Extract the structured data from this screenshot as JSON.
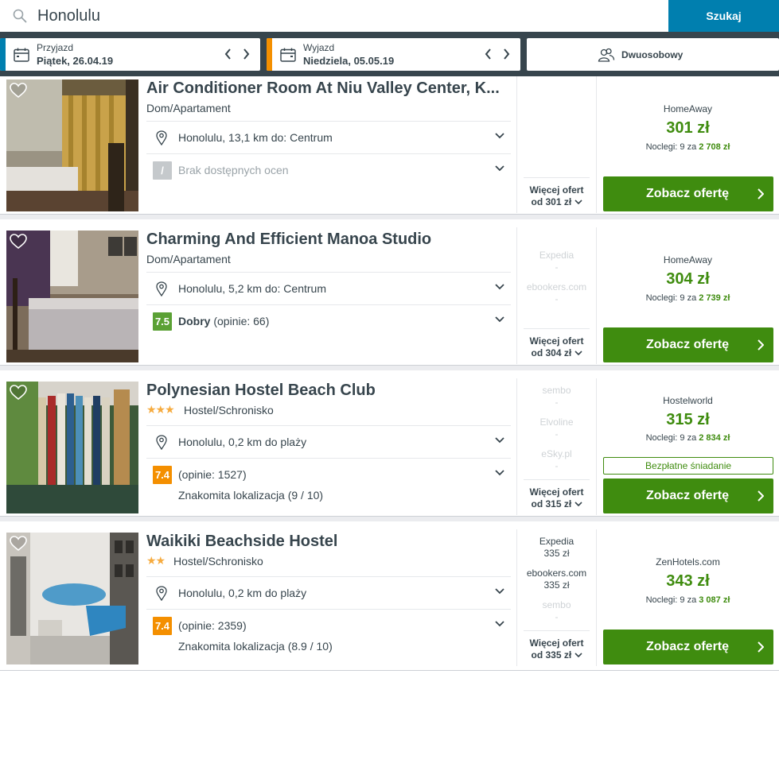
{
  "search": {
    "query": "Honolulu",
    "button_label": "Szukaj"
  },
  "dates": {
    "checkin": {
      "label": "Przyjazd",
      "value": "Piątek, 26.04.19",
      "accent": "#007faf"
    },
    "checkout": {
      "label": "Wyjazd",
      "value": "Niedziela, 05.05.19",
      "accent": "#f48f00"
    },
    "room": "Dwuosobowy"
  },
  "colors": {
    "price_green": "#3f8c0f",
    "rating_green": "#5ba135",
    "rating_orange": "#f48f00",
    "dark": "#37454d",
    "search_blue": "#007faf"
  },
  "listings": [
    {
      "title": "Air Conditioner Room At Niu Valley Center, K...",
      "type": "Dom/Apartament",
      "stars": "",
      "location": "Honolulu, 13,1 km do: Centrum",
      "rating_badge": "/",
      "rating_text": "Brak dostępnych ocen",
      "rating_sub": "",
      "partners": [],
      "more_line1": "Więcej ofert",
      "more_line2": "od 301 zł",
      "provider": "HomeAway",
      "price": "301 zł",
      "nights_prefix": "Noclegi: 9 za",
      "nights_total": "2 708 zł",
      "perk": "",
      "cta": "Zobacz ofertę"
    },
    {
      "title": "Charming And Efficient Manoa Studio",
      "type": "Dom/Apartament",
      "stars": "",
      "location": "Honolulu, 5,2 km do: Centrum",
      "rating_badge": "7.5",
      "rating_word": "Dobry",
      "rating_text": "(opinie: 66)",
      "rating_sub": "",
      "partners": [
        {
          "name": "Expedia",
          "price": "-"
        },
        {
          "name": "ebookers.com",
          "price": "-"
        }
      ],
      "more_line1": "Więcej ofert",
      "more_line2": "od 304 zł",
      "provider": "HomeAway",
      "price": "304 zł",
      "nights_prefix": "Noclegi: 9 za",
      "nights_total": "2 739 zł",
      "perk": "",
      "cta": "Zobacz ofertę"
    },
    {
      "title": "Polynesian Hostel Beach Club",
      "type": "Hostel/Schronisko",
      "stars": "★★★",
      "location": "Honolulu, 0,2 km do plaży",
      "rating_badge": "7.4",
      "rating_text": "(opinie: 1527)",
      "rating_sub": "Znakomita lokalizacja (9 / 10)",
      "partners": [
        {
          "name": "sembo",
          "price": "-"
        },
        {
          "name": "Elvoline",
          "price": "-"
        },
        {
          "name": "eSky.pl",
          "price": "-"
        }
      ],
      "more_line1": "Więcej ofert",
      "more_line2": "od 315 zł",
      "provider": "Hostelworld",
      "price": "315 zł",
      "nights_prefix": "Noclegi: 9 za",
      "nights_total": "2 834 zł",
      "perk": "Bezpłatne śniadanie",
      "cta": "Zobacz ofertę"
    },
    {
      "title": "Waikiki Beachside Hostel",
      "type": "Hostel/Schronisko",
      "stars": "★★",
      "location": "Honolulu, 0,2 km do plaży",
      "rating_badge": "7.4",
      "rating_text": "(opinie: 2359)",
      "rating_sub": "Znakomita lokalizacja (8.9 / 10)",
      "partners": [
        {
          "name": "Expedia",
          "price": "335 zł"
        },
        {
          "name": "ebookers.com",
          "price": "335 zł"
        },
        {
          "name": "sembo",
          "price": "-"
        }
      ],
      "more_line1": "Więcej ofert",
      "more_line2": "od 335 zł",
      "provider": "ZenHotels.com",
      "price": "343 zł",
      "nights_prefix": "Noclegi: 9 za",
      "nights_total": "3 087 zł",
      "perk": "",
      "cta": "Zobacz ofertę"
    }
  ]
}
